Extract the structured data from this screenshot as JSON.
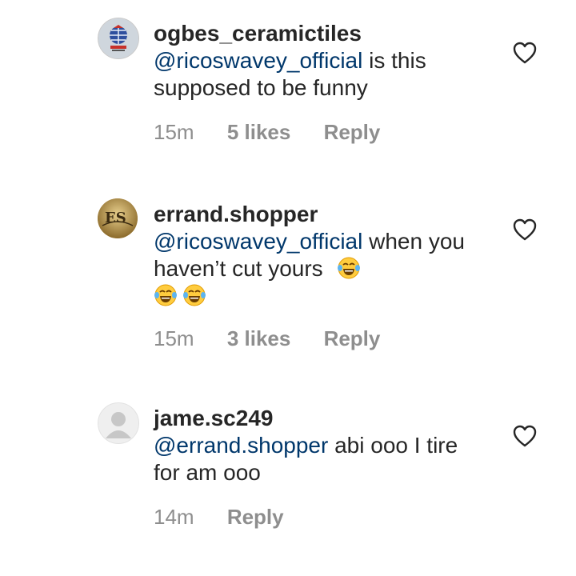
{
  "comments": [
    {
      "username": "ogbes_ceramictiles",
      "mention": "@ricoswavey_official",
      "text": " is this supposed to be funny",
      "time": "15m",
      "likes": "5 likes",
      "reply": "Reply",
      "avatar_icon": "ceramic-tiles-logo-icon"
    },
    {
      "username": "errand.shopper",
      "mention": "@ricoswavey_official",
      "text": " when you haven’t cut yours",
      "emojis": [
        "😂",
        "😂",
        "😂"
      ],
      "time": "15m",
      "likes": "3 likes",
      "reply": "Reply",
      "avatar_icon": "errand-shopper-logo-icon"
    },
    {
      "username": "jame.sc249",
      "mention": "@errand.shopper",
      "text": " abi ooo I tire for am ooo",
      "time": "14m",
      "reply": "Reply",
      "avatar_icon": "default-avatar-icon"
    }
  ],
  "colors": {
    "text": "#262626",
    "mention": "#00376b",
    "meta": "#8e8e8e"
  }
}
